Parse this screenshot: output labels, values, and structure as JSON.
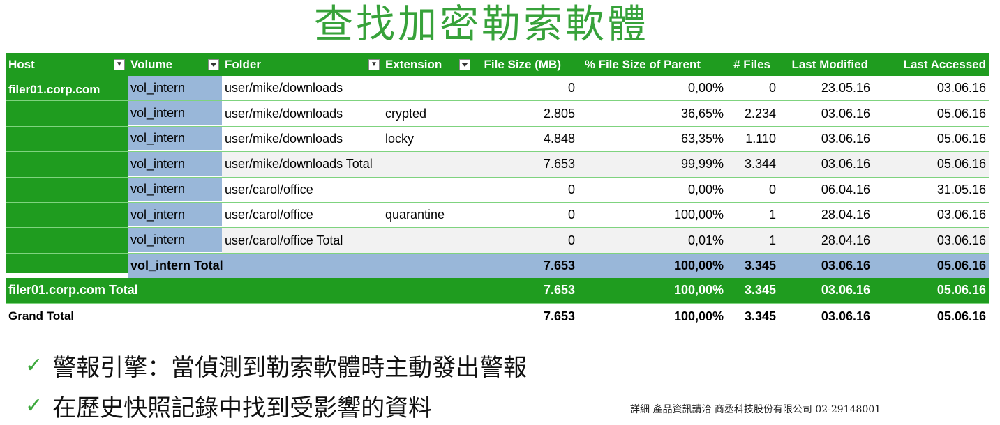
{
  "title": "查找加密勒索軟體",
  "colors": {
    "green": "#1f9c1f",
    "blue": "#99b7d9",
    "title_green": "#37A23A"
  },
  "headers": {
    "host": "Host",
    "volume": "Volume",
    "folder": "Folder",
    "extension": "Extension",
    "size": "File Size (MB)",
    "pct": "% File Size of Parent",
    "files": "# Files",
    "modified": "Last Modified",
    "accessed": "Last Accessed"
  },
  "host_name": "filer01.corp.com",
  "rows": [
    {
      "volume": "vol_intern",
      "folder": "user/mike/downloads",
      "extension": "",
      "size": "0",
      "pct": "0,00%",
      "files": "0",
      "modified": "23.05.16",
      "accessed": "03.06.16"
    },
    {
      "volume": "vol_intern",
      "folder": "user/mike/downloads",
      "extension": "crypted",
      "size": "2.805",
      "pct": "36,65%",
      "files": "2.234",
      "modified": "03.06.16",
      "accessed": "05.06.16"
    },
    {
      "volume": "vol_intern",
      "folder": "user/mike/downloads",
      "extension": "locky",
      "size": "4.848",
      "pct": "63,35%",
      "files": "1.110",
      "modified": "03.06.16",
      "accessed": "05.06.16"
    },
    {
      "volume": "vol_intern",
      "folder": "user/mike/downloads Total",
      "extension": "",
      "size": "7.653",
      "pct": "99,99%",
      "files": "3.344",
      "modified": "03.06.16",
      "accessed": "05.06.16"
    },
    {
      "volume": "vol_intern",
      "folder": "user/carol/office",
      "extension": "",
      "size": "0",
      "pct": "0,00%",
      "files": "0",
      "modified": "06.04.16",
      "accessed": "31.05.16"
    },
    {
      "volume": "vol_intern",
      "folder": "user/carol/office",
      "extension": "quarantine",
      "size": "0",
      "pct": "100,00%",
      "files": "1",
      "modified": "28.04.16",
      "accessed": "03.06.16"
    },
    {
      "volume": "vol_intern",
      "folder": "user/carol/office Total",
      "extension": "",
      "size": "0",
      "pct": "0,01%",
      "files": "1",
      "modified": "28.04.16",
      "accessed": "03.06.16"
    }
  ],
  "volume_total": {
    "label": "vol_intern Total",
    "size": "7.653",
    "pct": "100,00%",
    "files": "3.345",
    "modified": "03.06.16",
    "accessed": "05.06.16"
  },
  "host_total": {
    "label": "filer01.corp.com Total",
    "size": "7.653",
    "pct": "100,00%",
    "files": "3.345",
    "modified": "03.06.16",
    "accessed": "05.06.16"
  },
  "grand_total": {
    "label": "Grand Total",
    "size": "7.653",
    "pct": "100,00%",
    "files": "3.345",
    "modified": "03.06.16",
    "accessed": "05.06.16"
  },
  "bullets": [
    {
      "icon": "check-icon",
      "text": "警報引擎：當偵測到勒索軟體時主動發出警報"
    },
    {
      "icon": "check-icon",
      "text": "在歷史快照記錄中找到受影響的資料"
    }
  ],
  "footer": "詳細 產品資訊請洽 商丞科技股份有限公司 02-29148001"
}
